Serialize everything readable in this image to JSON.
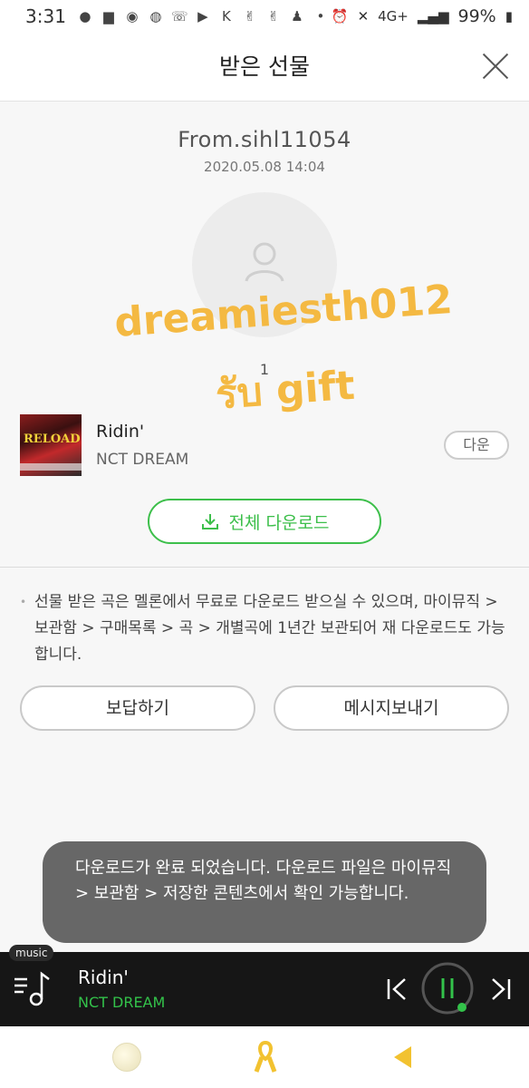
{
  "status_bar": {
    "time": "3:31",
    "network": "4G+",
    "battery": "99%"
  },
  "header": {
    "title": "받은 선물"
  },
  "gift": {
    "from": "From.sihl11054",
    "date": "2020.05.08 14:04",
    "count": "1"
  },
  "watermark": {
    "line1": "dreamiesth012",
    "line2": "รับ gift"
  },
  "song": {
    "title": "Ridin'",
    "artist": "NCT DREAM",
    "cover_text": "RELOAD",
    "download_label": "다운"
  },
  "all_download_label": "전체 다운로드",
  "notice": "선물 받은 곡은 멜론에서 무료로 다운로드 받으실 수 있으며, 마이뮤직 > 보관함 > 구매목록 > 곡 > 개별곡에 1년간 보관되어 재 다운로드도 가능합니다.",
  "actions": {
    "reply_label": "보답하기",
    "message_label": "메시지보내기"
  },
  "toast": "다운로드가 완료 되었습니다. 다운로드 파일은 마이뮤직 > 보관함 > 저장한 콘텐츠에서 확인 가능합니다.",
  "player": {
    "tag": "music",
    "title": "Ridin'",
    "artist": "NCT DREAM",
    "accent_color": "#33c24a"
  }
}
